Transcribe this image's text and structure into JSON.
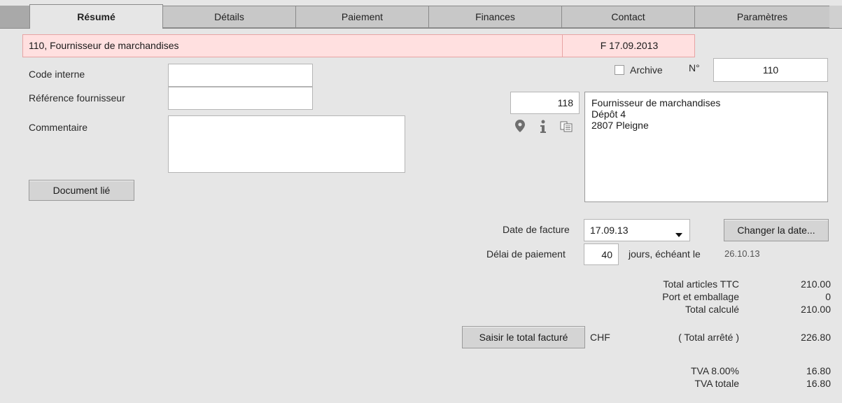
{
  "tabs": [
    "Résumé",
    "Détails",
    "Paiement",
    "Finances",
    "Contact",
    "Paramètres"
  ],
  "header": {
    "supplier": "110, Fournisseur de marchandises",
    "invoice_ref": "F 17.09.2013"
  },
  "form": {
    "code_interne_label": "Code interne",
    "code_interne_value": "",
    "reference_label": "Référence fournisseur",
    "reference_value": "",
    "commentaire_label": "Commentaire",
    "commentaire_value": "",
    "document_lie_label": "Document lié",
    "archive_label": "Archive",
    "archive_checked": false,
    "numero_label": "N°",
    "numero_value": "110",
    "address_number": "118",
    "address_lines": [
      "Fournisseur de marchandises",
      "Dépôt 4",
      "2807 Pleigne"
    ],
    "date_facture_label": "Date de facture",
    "date_facture_value": "17.09.13",
    "changer_date_label": "Changer la date...",
    "delai_label": "Délai de paiement",
    "delai_value": "40",
    "jours_label": "jours, échéant le",
    "echeance_value": "26.10.13"
  },
  "totals": {
    "total_articles_label": "Total articles TTC",
    "total_articles_value": "210.00",
    "port_label": "Port et emballage",
    "port_value": "0",
    "total_calcule_label": "Total calculé",
    "total_calcule_value": "210.00",
    "saisir_label": "Saisir le total facturé",
    "currency": "CHF",
    "total_arrete_label": "( Total arrêté )",
    "total_arrete_value": "226.80",
    "tva_rate_label": "TVA 8.00%",
    "tva_rate_value": "16.80",
    "tva_totale_label": "TVA totale",
    "tva_totale_value": "16.80"
  },
  "icons": [
    "map-pin-icon",
    "info-icon",
    "copy-icon",
    "dropdown-arrow-icon"
  ]
}
